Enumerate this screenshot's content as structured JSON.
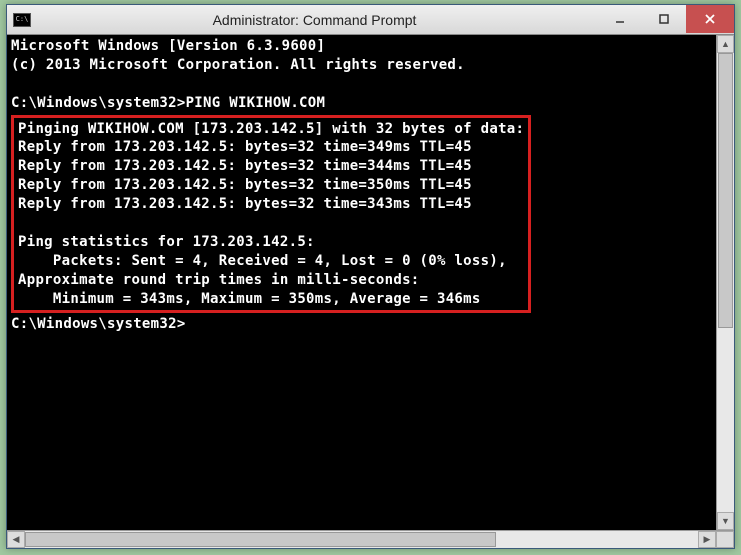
{
  "window": {
    "title": "Administrator: Command Prompt",
    "icon_text": "C:\\"
  },
  "terminal": {
    "header1": "Microsoft Windows [Version 6.3.9600]",
    "header2": "(c) 2013 Microsoft Corporation. All rights reserved.",
    "prompt1": "C:\\Windows\\system32>PING WIKIHOW.COM",
    "ping_header": "Pinging WIKIHOW.COM [173.203.142.5] with 32 bytes of data:",
    "reply1": "Reply from 173.203.142.5: bytes=32 time=349ms TTL=45",
    "reply2": "Reply from 173.203.142.5: bytes=32 time=344ms TTL=45",
    "reply3": "Reply from 173.203.142.5: bytes=32 time=350ms TTL=45",
    "reply4": "Reply from 173.203.142.5: bytes=32 time=343ms TTL=45",
    "stats_header": "Ping statistics for 173.203.142.5:",
    "stats_packets": "    Packets: Sent = 4, Received = 4, Lost = 0 (0% loss),",
    "stats_rtt_header": "Approximate round trip times in milli-seconds:",
    "stats_rtt": "    Minimum = 343ms, Maximum = 350ms, Average = 346ms",
    "prompt2": "C:\\Windows\\system32>"
  }
}
